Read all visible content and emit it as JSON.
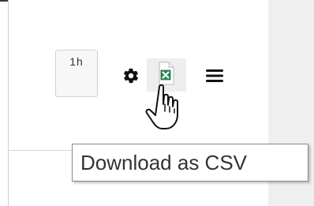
{
  "toolbar": {
    "time_range_label": "1h",
    "settings_icon": "gear-icon",
    "download_icon": "csv-download-icon",
    "menu_icon": "hamburger-menu-icon"
  },
  "tooltip": {
    "text": "Download as CSV"
  },
  "colors": {
    "icon_dark": "#111111",
    "csv_green": "#2e8b57",
    "panel_border": "#cfcfcf",
    "right_panel": "#efefef"
  }
}
